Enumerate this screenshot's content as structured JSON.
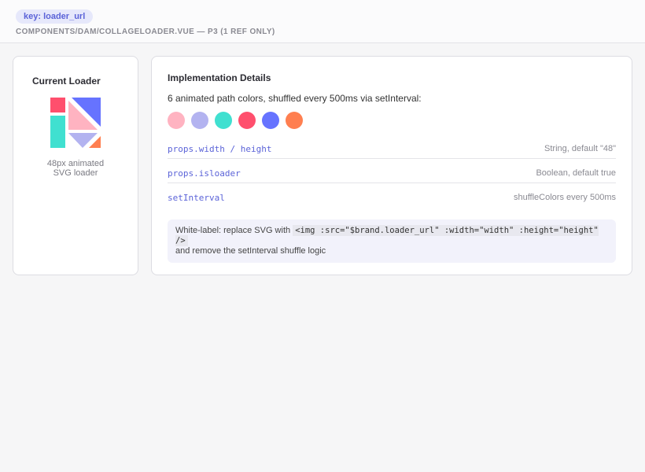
{
  "header": {
    "key_badge": "key: loader_url",
    "path": "COMPONENTS/DAM/COLLAGELOADER.VUE — P3 (1 REF ONLY)"
  },
  "loader_card": {
    "title": "Current Loader",
    "caption_line1": "48px animated",
    "caption_line2": "SVG loader"
  },
  "impl": {
    "title": "Implementation Details",
    "description": "6 animated path colors, shuffled every 500ms via setInterval:",
    "colors": [
      "#ffb3c1",
      "#b3b3f0",
      "#40e0d0",
      "#ff4f6d",
      "#6673ff",
      "#ff7f50"
    ],
    "rows": [
      {
        "key": "props.width / height",
        "value": "String, default \"48\""
      },
      {
        "key": "props.isloader",
        "value": "Boolean, default true"
      },
      {
        "key": "setInterval",
        "value": "shuffleColors every 500ms"
      }
    ],
    "note": {
      "prefix": "White-label: replace SVG with",
      "code": "<img :src=\"$brand.loader_url\" :width=\"width\" :height=\"height\" />",
      "suffix": "and remove the setInterval shuffle logic"
    }
  }
}
